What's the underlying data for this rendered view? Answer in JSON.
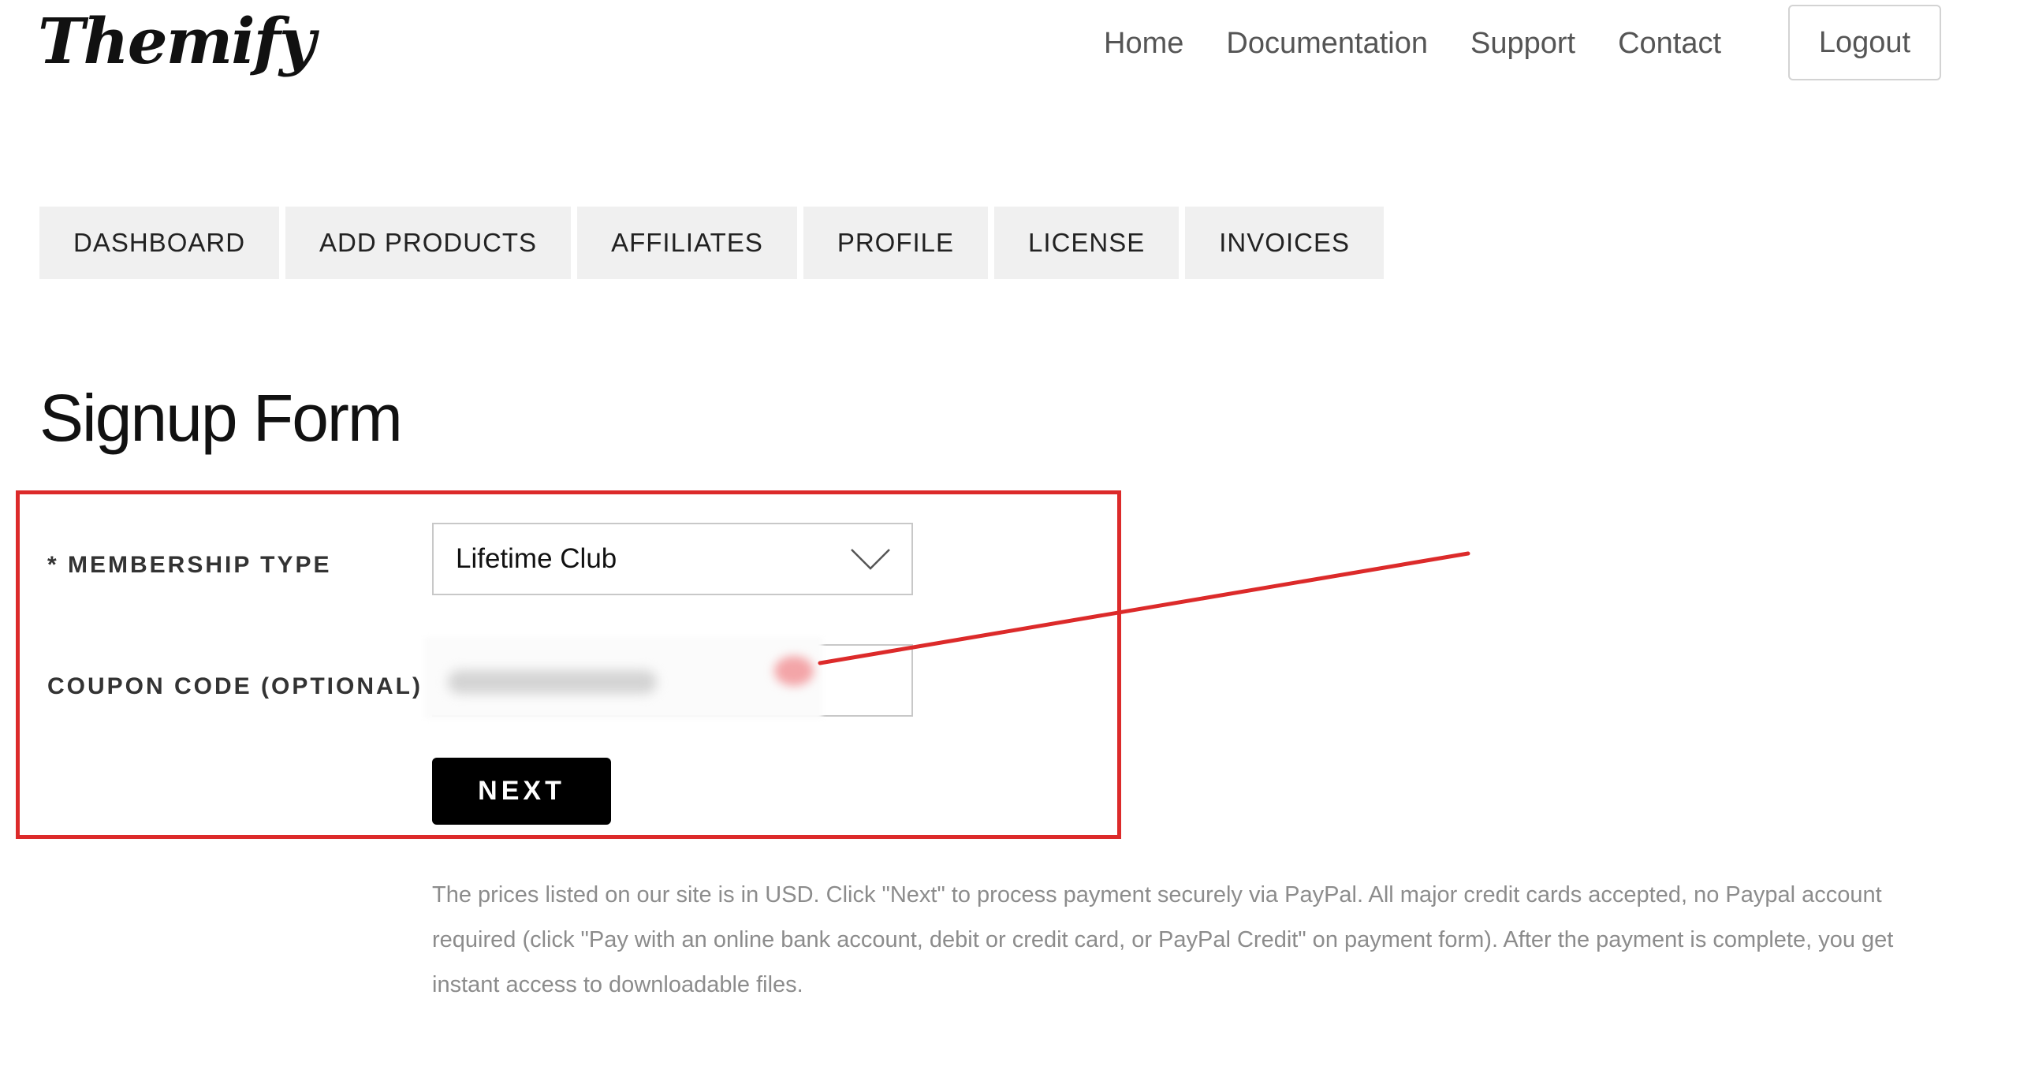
{
  "header": {
    "logo_text": "Themify",
    "nav": [
      "Home",
      "Documentation",
      "Support",
      "Contact"
    ],
    "logout_label": "Logout"
  },
  "tabs": [
    "DASHBOARD",
    "ADD PRODUCTS",
    "AFFILIATES",
    "PROFILE",
    "LICENSE",
    "INVOICES"
  ],
  "form": {
    "title": "Signup Form",
    "membership_label": "* MEMBERSHIP TYPE",
    "membership_value": "Lifetime Club",
    "coupon_label": "COUPON CODE (OPTIONAL)",
    "next_label": "NEXT"
  },
  "notice": "The prices listed on our site is in USD. Click \"Next\" to process payment securely via PayPal. All major credit cards accepted, no Paypal account required (click \"Pay with an online bank account, debit or credit card, or PayPal Credit\" on payment form). After the payment is complete, you get instant access to downloadable files.",
  "colors": {
    "highlight": "#dc2a2a",
    "tab_bg": "#f0f0f0",
    "button_bg": "#000000",
    "notice_text": "#8c8c8c"
  },
  "icons": {
    "select_arrow": "chevron-down-icon"
  }
}
